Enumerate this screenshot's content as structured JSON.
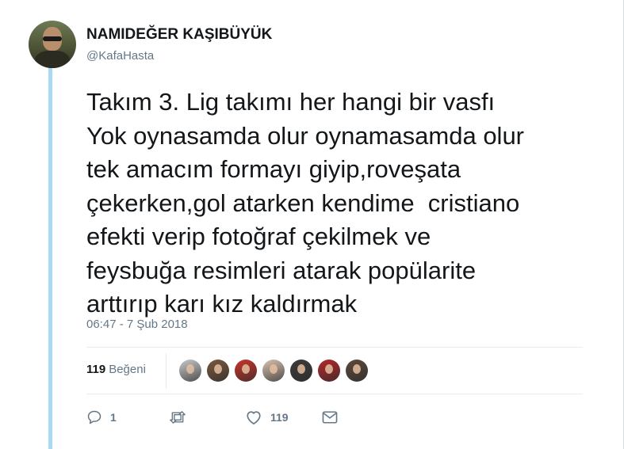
{
  "author": {
    "display_name": "NAMIDEĞER KAŞIBÜYÜK",
    "handle": "@KafaHasta"
  },
  "tweet": {
    "lines": [
      "Takım 3. Lig takımı her hangi bir vasfı",
      "Yok oynasamda olur oynamasamda olur",
      "tek amacım formayı giyip,roveşata",
      "çekerken,gol atarken kendime  cristiano",
      "efekti verip fotoğraf çekilmek ve",
      "feysbuğa resimleri atarak popülarite",
      "arttırıp karı kız kaldırmak"
    ],
    "timestamp": "06:47 - 7 Şub 2018"
  },
  "stats": {
    "likes_count": "119",
    "likes_label": "Beğeni",
    "liker_avatars": [
      {
        "name": "liker-avatar-1",
        "color": "#c9c9c9"
      },
      {
        "name": "liker-avatar-2",
        "color": "#7a5a3e"
      },
      {
        "name": "liker-avatar-3",
        "color": "#c8362b"
      },
      {
        "name": "liker-avatar-4",
        "color": "#d8c2b0"
      },
      {
        "name": "liker-avatar-5",
        "color": "#3c3c3c"
      },
      {
        "name": "liker-avatar-6",
        "color": "#b5282a"
      },
      {
        "name": "liker-avatar-7",
        "color": "#5d4a3c"
      }
    ]
  },
  "actions": {
    "reply_count": "1",
    "retweet_count": "",
    "like_count": "119",
    "icons": [
      "reply-icon",
      "retweet-icon",
      "heart-icon",
      "message-icon"
    ]
  },
  "colors": {
    "thread_line": "#a8daf5",
    "muted_text": "#657786",
    "primary_text": "#14171a"
  }
}
